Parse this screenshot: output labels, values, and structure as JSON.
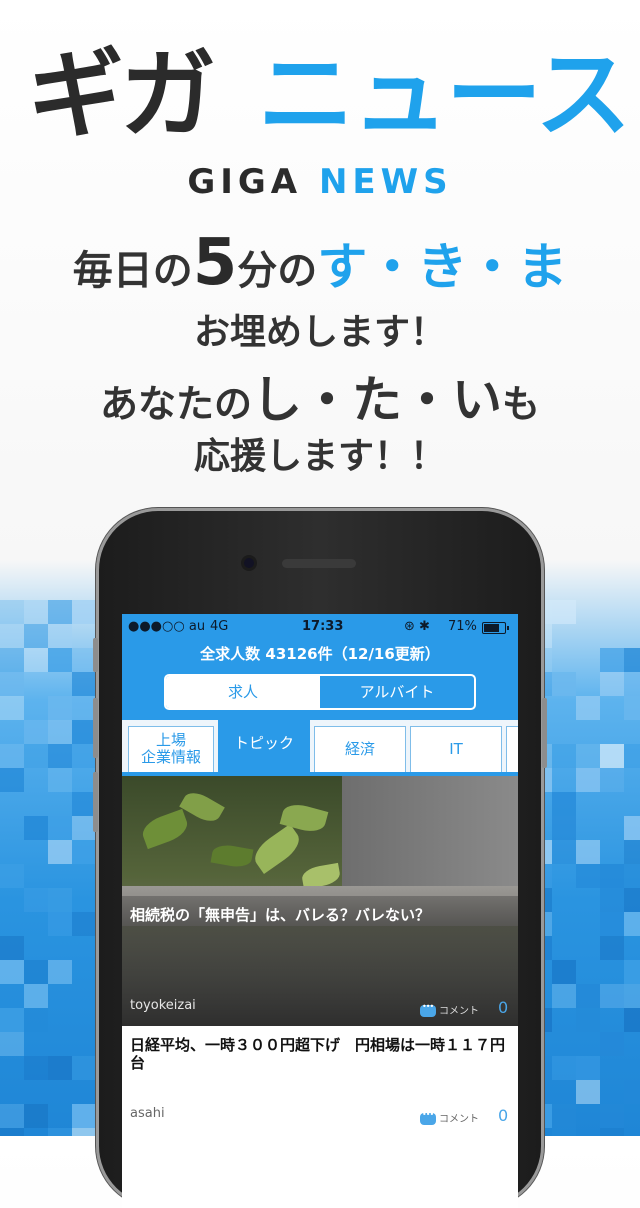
{
  "promo": {
    "logo_dark": "ギガ",
    "logo_blue": "ニュース",
    "subtitle_dark": "GIGA",
    "subtitle_blue": "NEWS",
    "line1_a": "毎日の",
    "line1_num": "5",
    "line1_b": "分の",
    "line1_blue": "す・き・ま",
    "line2": "お埋めします！",
    "line3_a": "あなたの",
    "line3_big": "し・た・い",
    "line3_b": "も",
    "line4": "応援します！！"
  },
  "status": {
    "carrier": "●●●○○ au",
    "network": "4G",
    "time": "17:33",
    "icons": "⊛ ✱",
    "battery": "71%"
  },
  "header": {
    "job_count": "全求人数 43126件（12/16更新）",
    "segments": [
      "求人",
      "アルバイト"
    ],
    "selected_segment": "求人"
  },
  "tabs": [
    {
      "label": "上場\n企業情報"
    },
    {
      "label": "トピック",
      "active": true
    },
    {
      "label": "経済"
    },
    {
      "label": "IT"
    }
  ],
  "articles": [
    {
      "title": "相続税の「無申告」は、バレる？バレない？",
      "source": "toyokeizai",
      "comment_label": "コメント",
      "comment_count": "0"
    },
    {
      "title": "日経平均、一時３００円超下げ　円相場は一時１１７円台",
      "source": "asahi",
      "comment_label": "コメント",
      "comment_count": "0"
    }
  ],
  "colors": {
    "accent": "#1fa2ec",
    "app_blue": "#2a9ae8",
    "dark": "#2b2b2b"
  }
}
